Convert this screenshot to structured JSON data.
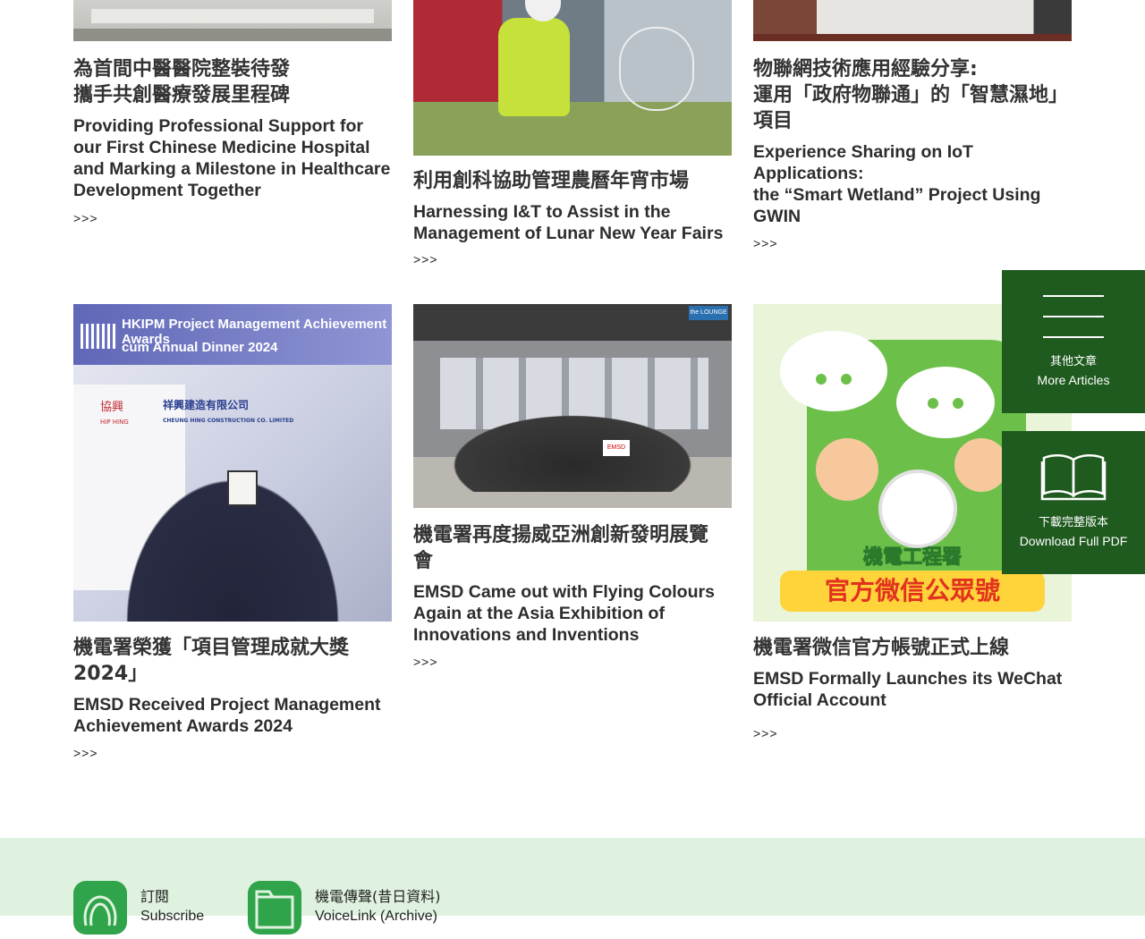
{
  "articles": [
    {
      "zh": "為首間中醫醫院整裝待發攜手共創醫療發展里程碑",
      "zh_l1": "為首間中醫醫院整裝待發",
      "zh_l2": "攜手共創醫療發展里程碑",
      "en": "Providing Professional Support for our First Chinese Medicine Hospital and Marking a Milestone in Healthcare Development Together",
      "more": ">>>"
    },
    {
      "zh": "利用創科協助管理農曆年宵市場",
      "en": "Harnessing I&T to Assist in the Management of Lunar New Year Fairs",
      "more": ">>>"
    },
    {
      "zh_l1": "物聯網技術應用經驗分享:",
      "zh_l2": "運用「政府物聯通」的「智慧濕地」項目",
      "en_l1": "Experience Sharing on IoT Applications:",
      "en_l2": "the “Smart Wetland” Project Using GWIN",
      "more": ">>>"
    },
    {
      "zh": "機電署榮獲「項目管理成就大獎2024」",
      "en": "EMSD Received Project Management Achievement Awards 2024",
      "more": ">>>",
      "banner_l1": "HKIPM Project Management Achievement Awards",
      "banner_l2": "cum Annual Dinner 2024",
      "sponsor1": "協興",
      "sponsor1_en": "HIP HING",
      "sponsor2": "祥興建造有限公司",
      "sponsor2_en": "CHEUNG HING CONSTRUCTION CO. LIMITED"
    },
    {
      "zh": "機電署再度揚威亞洲創新發明展覽會",
      "en": "EMSD Came out with Flying Colours Again at the Asia Exhibition of Innovations and Inventions",
      "more": ">>>",
      "sign": "the LOUNGE",
      "plate": "EMSD"
    },
    {
      "zh": "機電署微信官方帳號正式上線",
      "en": "EMSD Formally Launches its WeChat Official Account",
      "more": ">>>",
      "poster_l1": "機電工程署",
      "poster_l2": "官方微信公眾號"
    }
  ],
  "side": {
    "more": {
      "zh": "其他文章",
      "en": "More Articles",
      "icon": "menu-lines-icon"
    },
    "pdf": {
      "zh": "下載完整版本",
      "en": "Download Full PDF",
      "icon": "open-book-icon"
    }
  },
  "footer": {
    "subscribe": {
      "zh": "訂閱",
      "en": "Subscribe",
      "icon": "subscribe-icon"
    },
    "archive": {
      "zh": "機電傳聲(昔日資料)",
      "en": "VoiceLink (Archive)",
      "icon": "folder-icon"
    }
  },
  "colors": {
    "side_green": "#1f5a1f",
    "footer_bg": "#dff2df",
    "icon_green": "#2fa44a"
  }
}
